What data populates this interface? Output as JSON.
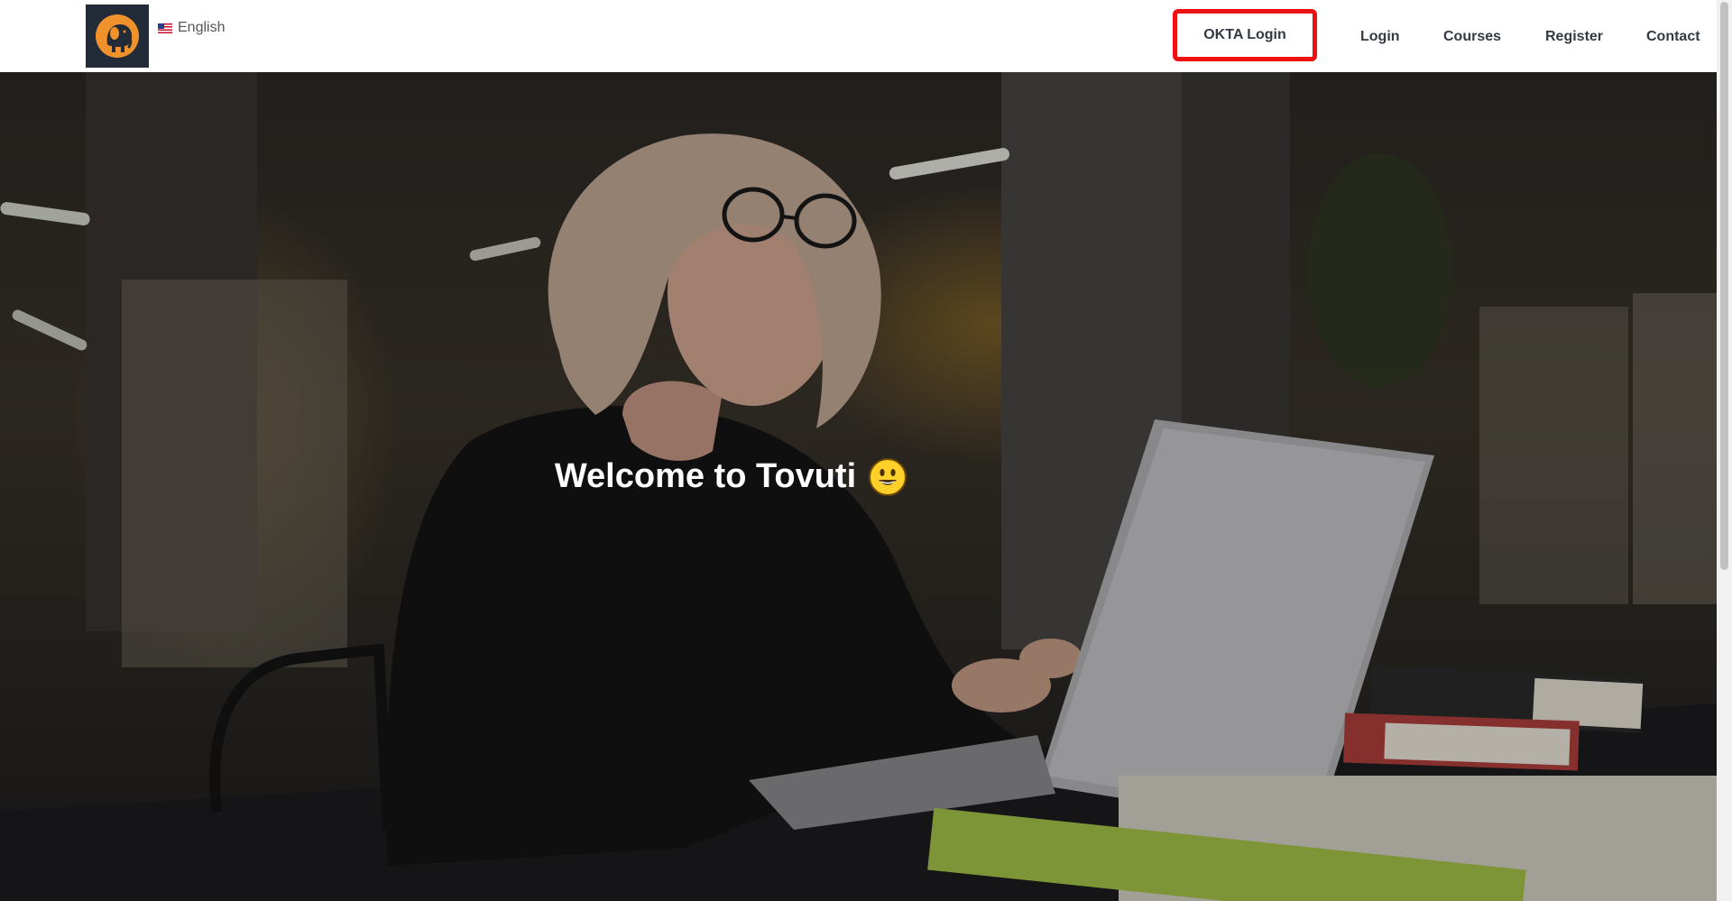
{
  "header": {
    "logo_alt": "Tovuti elephant logo",
    "language": {
      "flag_icon": "us-flag-icon",
      "label": "English"
    },
    "nav": {
      "okta_login": "OKTA Login",
      "login": "Login",
      "courses": "Courses",
      "register": "Register",
      "contact": "Contact"
    }
  },
  "hero": {
    "title": "Welcome to Tovuti",
    "emoji_icon": "grinning-face-icon"
  },
  "colors": {
    "highlight_border": "#ee1111",
    "logo_bg": "#232a38",
    "logo_accent": "#f0922b",
    "nav_text": "#333a44"
  }
}
